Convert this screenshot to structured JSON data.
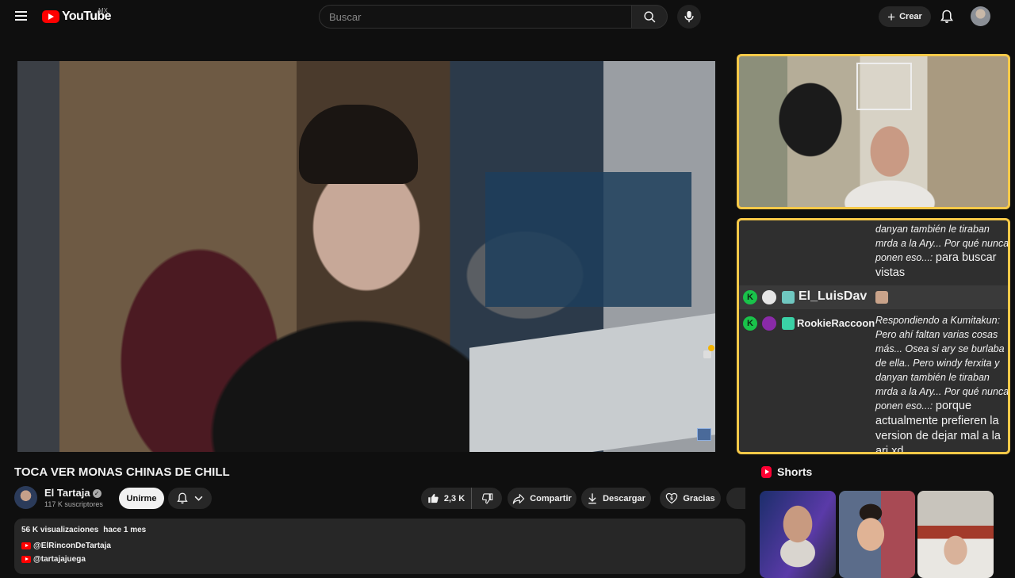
{
  "header": {
    "logo_text": "YouTube",
    "country": "MX",
    "search_placeholder": "Buscar",
    "create_label": "Crear"
  },
  "chat": {
    "message1": {
      "reply_text": "danyan también le tiraban mrda a la Ary... Por qué nunca ponen eso...:",
      "text": "para buscar vistas"
    },
    "user_row": {
      "badge": "K",
      "username": "El_LuisDav"
    },
    "message2": {
      "badge": "K",
      "username": "RookieRaccoon",
      "reply_text": "Respondiendo a Kumitakun: Pero ahí faltan varias cosas más... Osea si ary se burlaba de ella.. Pero windy ferxita y danyan también le tiraban mrda a la Ary... Por qué nunca ponen eso...:",
      "text": "porque actualmente prefieren la version de dejar mal a la ari xd"
    }
  },
  "video": {
    "title": "TOCA VER MONAS CHINAS DE CHILL"
  },
  "channel": {
    "name": "El Tartaja",
    "verified_mark": "✓",
    "subscribers": "117 K suscriptores",
    "join_label": "Unirme"
  },
  "actions": {
    "likes": "2,3 K",
    "share": "Compartir",
    "download": "Descargar",
    "thanks": "Gracias"
  },
  "description": {
    "views": "56 K visualizaciones",
    "date": "hace 1 mes",
    "links": [
      "@ElRinconDeTartaja",
      "@tartajajuega"
    ]
  },
  "shorts": {
    "title": "Shorts"
  },
  "colors": {
    "overlay_border": "#f7c948",
    "badge_green": "#19c34a",
    "brand_red": "#ff0000"
  },
  "icons": [
    "menu-icon",
    "youtube-logo-icon",
    "search-icon",
    "mic-icon",
    "plus-icon",
    "bell-icon",
    "lock-icon",
    "verified-icon",
    "chevron-down-icon",
    "thumbs-up-icon",
    "thumbs-down-icon",
    "share-icon",
    "download-icon",
    "heart-dollar-icon",
    "shorts-icon"
  ]
}
